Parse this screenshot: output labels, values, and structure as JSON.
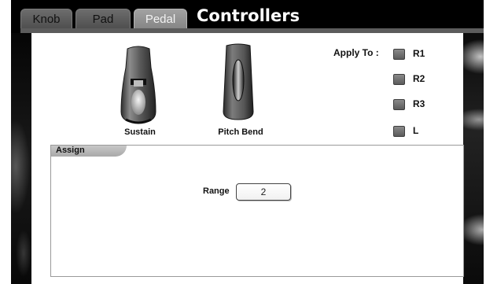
{
  "tabs": [
    {
      "label": "Knob",
      "active": false
    },
    {
      "label": "Pad",
      "active": false
    },
    {
      "label": "Pedal",
      "active": true
    }
  ],
  "header": {
    "title": "Controllers"
  },
  "pedals": [
    {
      "label": "Sustain",
      "icon": "sustain-pedal-icon"
    },
    {
      "label": "Pitch Bend",
      "icon": "pitch-bend-pedal-icon"
    }
  ],
  "apply_to": {
    "label": "Apply To :",
    "options": [
      {
        "label": "R1",
        "checked": false
      },
      {
        "label": "R2",
        "checked": false
      },
      {
        "label": "R3",
        "checked": false
      },
      {
        "label": "L",
        "checked": false
      }
    ]
  },
  "assign": {
    "title": "Assign",
    "range_label": "Range",
    "range_value": "2"
  },
  "colors": {
    "background": "#000000",
    "panel": "#ffffff",
    "active_tab": "#9a9a9a",
    "inactive_tab": "#5e5e5e",
    "checkbox": "#6e6e6e"
  }
}
